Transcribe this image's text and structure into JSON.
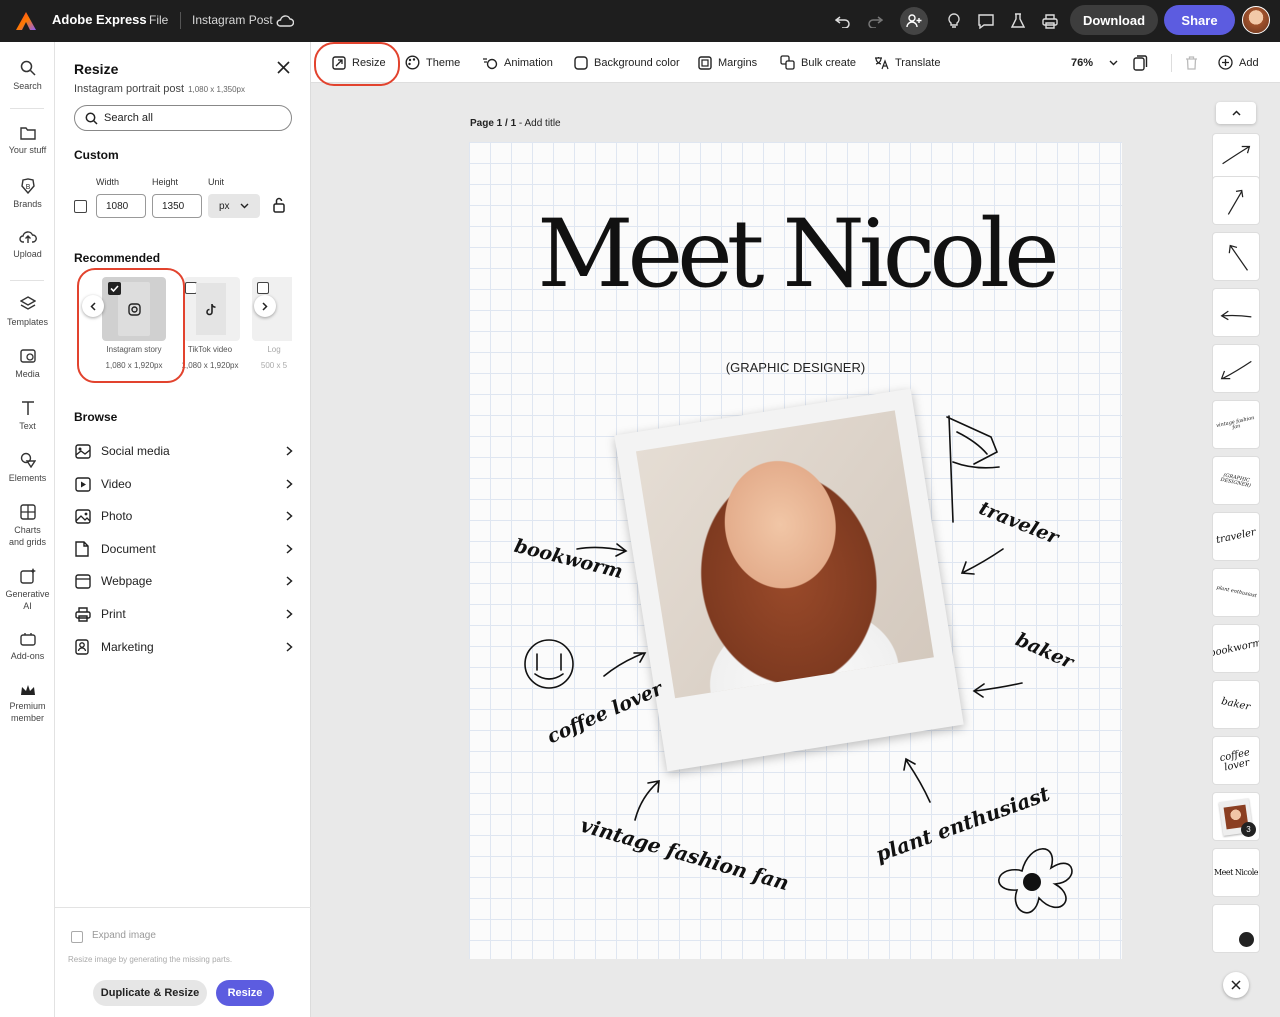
{
  "app": {
    "name": "Adobe Express",
    "file_menu": "File",
    "doc_name": "Instagram Post"
  },
  "header": {
    "download_label": "Download",
    "share_label": "Share"
  },
  "leftrail": {
    "items": [
      {
        "label": "Search",
        "icon": "search-icon"
      },
      {
        "label": "Your stuff",
        "icon": "folder-icon"
      },
      {
        "label": "Brands",
        "icon": "brand-icon"
      },
      {
        "label": "Upload",
        "icon": "upload-icon"
      },
      {
        "label": "Templates",
        "icon": "templates-icon"
      },
      {
        "label": "Media",
        "icon": "media-icon"
      },
      {
        "label": "Text",
        "icon": "text-icon"
      },
      {
        "label": "Elements",
        "icon": "elements-icon"
      },
      {
        "label": "Charts and grids",
        "icon": "charts-icon"
      },
      {
        "label": "Generative AI",
        "icon": "generative-ai-icon"
      },
      {
        "label": "Add-ons",
        "icon": "addons-icon"
      },
      {
        "label": "Premium member",
        "icon": "crown-icon"
      }
    ]
  },
  "panel": {
    "title": "Resize",
    "subtitle": "Instagram portrait post",
    "subtitle_size": "1,080 x 1,350px",
    "search_placeholder": "Search all",
    "custom": {
      "label": "Custom",
      "width_label": "Width",
      "height_label": "Height",
      "unit_label": "Unit",
      "width": "1080",
      "height": "1350",
      "unit": "px"
    },
    "recommended": {
      "label": "Recommended",
      "cards": [
        {
          "name": "Instagram story",
          "size": "1,080 x 1,920px",
          "checked": true
        },
        {
          "name": "TikTok video",
          "size": "1,080 x 1,920px",
          "checked": false
        },
        {
          "name": "Log",
          "size": "500 x 5",
          "checked": false
        }
      ]
    },
    "browse": {
      "label": "Browse",
      "items": [
        "Social media",
        "Video",
        "Photo",
        "Document",
        "Webpage",
        "Print",
        "Marketing"
      ]
    },
    "expand_label": "Expand image",
    "expand_hint": "Resize image by generating the missing parts.",
    "duplicate_label": "Duplicate & Resize",
    "resize_label": "Resize"
  },
  "toolbar": {
    "resize": "Resize",
    "theme": "Theme",
    "animation": "Animation",
    "background_color": "Background color",
    "margins": "Margins",
    "bulk_create": "Bulk create",
    "translate": "Translate",
    "zoom": "76%",
    "add": "Add"
  },
  "page": {
    "label": "Page 1 / 1",
    "add_title": "Add title"
  },
  "design": {
    "headline": "Meet Nicole",
    "subheadline": "(GRAPHIC DESIGNER)",
    "words": [
      "bookworm",
      "traveler",
      "baker",
      "coffee lover",
      "vintage fashion fan",
      "plant enthusiast"
    ]
  },
  "thumbs": [
    {
      "caption": ""
    },
    {
      "caption": ""
    },
    {
      "caption": ""
    },
    {
      "caption": ""
    },
    {
      "caption": ""
    },
    {
      "caption": "vintage fashion fan"
    },
    {
      "caption": "(GRAPHIC DESIGNER)"
    },
    {
      "caption": "traveler"
    },
    {
      "caption": "plant enthusiast"
    },
    {
      "caption": "bookworm"
    },
    {
      "caption": "baker"
    },
    {
      "caption": "coffee lover"
    },
    {
      "caption": "",
      "badge": "3"
    },
    {
      "caption": "Meet Nicole"
    },
    {
      "caption": ""
    }
  ],
  "colors": {
    "accent": "#5c5ce0",
    "highlight_ring": "#e2432e",
    "topbar": "#1e1e1e"
  }
}
